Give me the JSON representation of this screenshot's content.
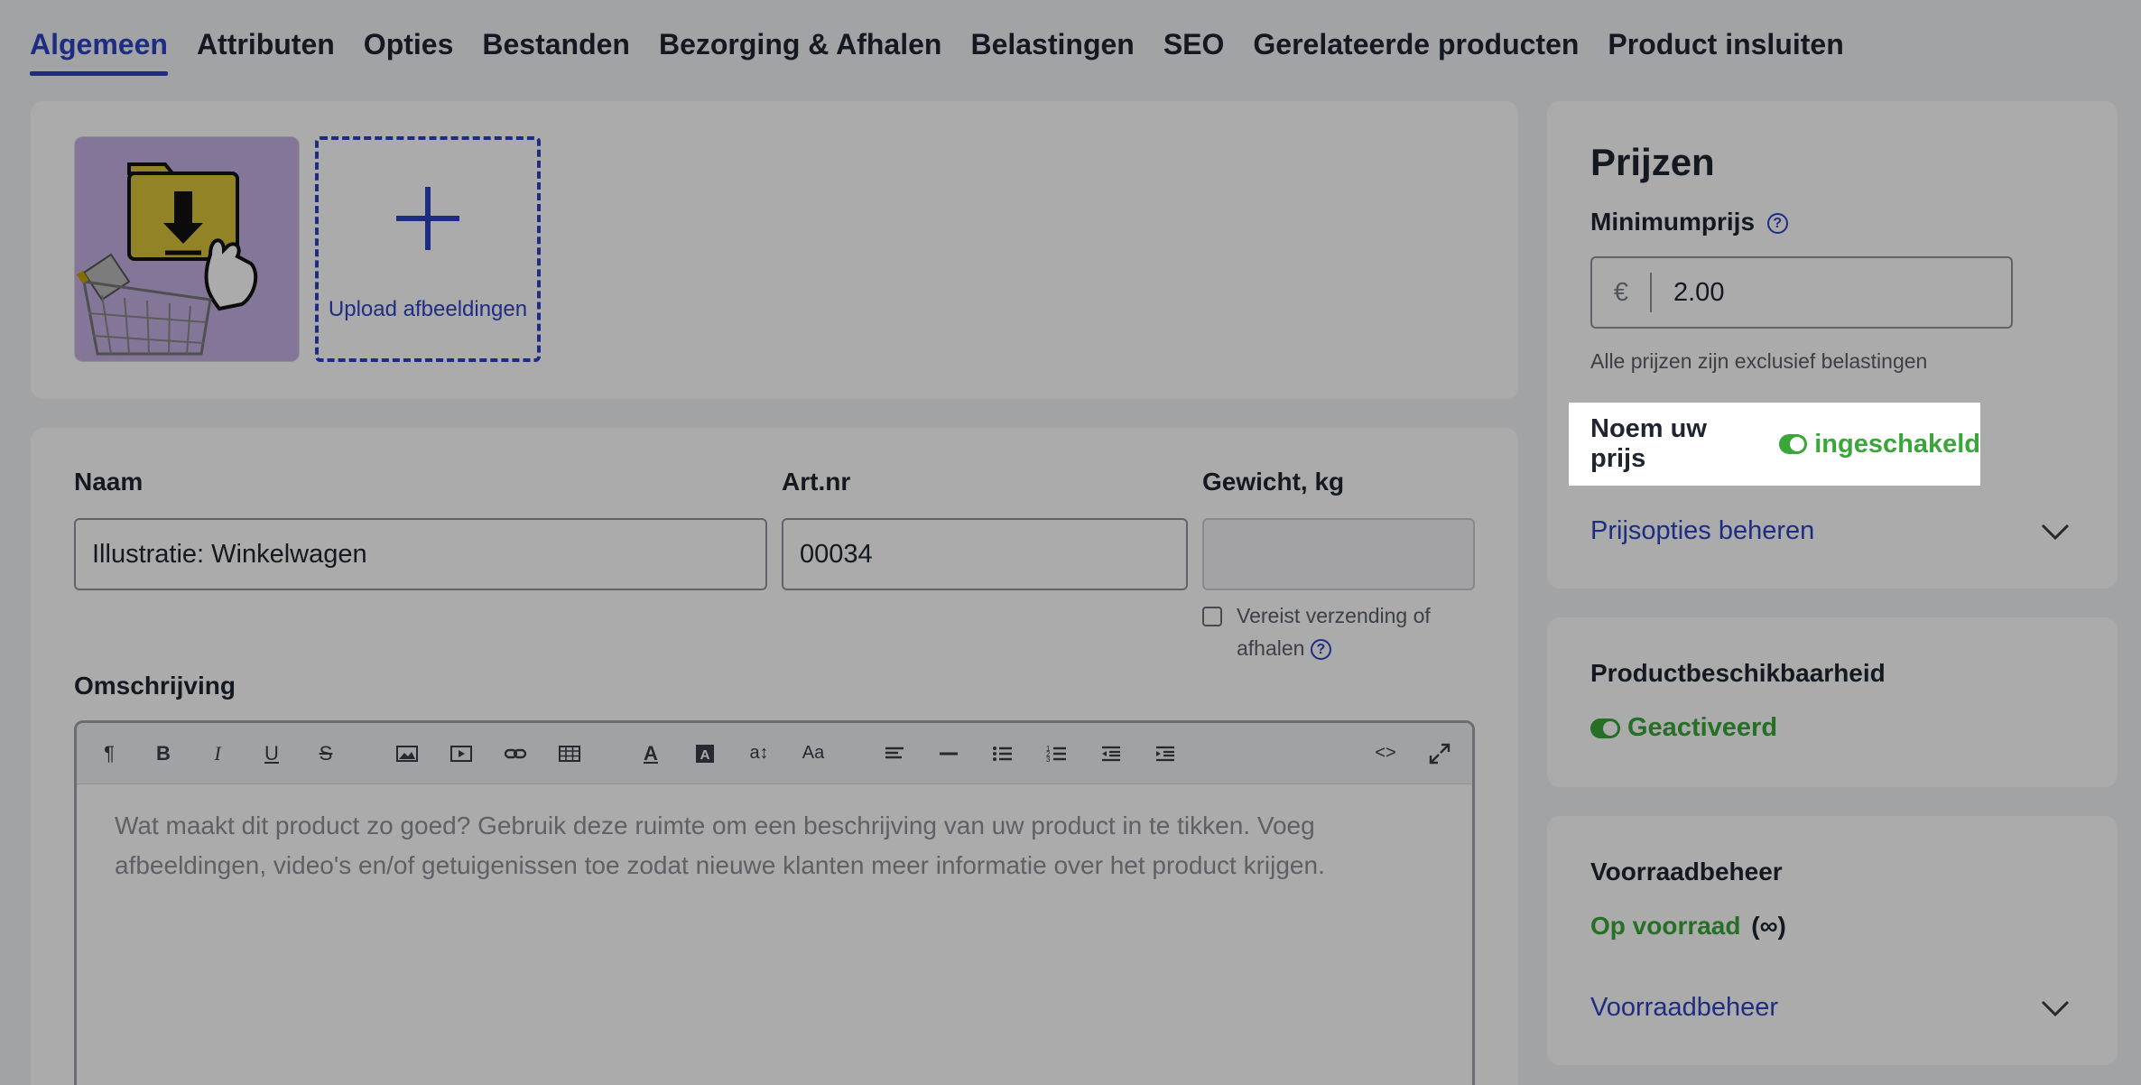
{
  "tabs": [
    {
      "label": "Algemeen",
      "active": true
    },
    {
      "label": "Attributen"
    },
    {
      "label": "Opties"
    },
    {
      "label": "Bestanden"
    },
    {
      "label": "Bezorging & Afhalen"
    },
    {
      "label": "Belastingen"
    },
    {
      "label": "SEO"
    },
    {
      "label": "Gerelateerde producten"
    },
    {
      "label": "Product insluiten"
    }
  ],
  "images": {
    "upload_label": "Upload afbeeldingen"
  },
  "form": {
    "name_label": "Naam",
    "name_value": "Illustratie: Winkelwagen",
    "sku_label": "Art.nr",
    "sku_value": "00034",
    "weight_label": "Gewicht, kg",
    "weight_value": "",
    "shipping_checkbox_label_line1": "Vereist verzending of",
    "shipping_checkbox_label_line2": "afhalen",
    "shipping_required": false,
    "description_label": "Omschrijving",
    "description_placeholder": "Wat maakt dit product zo goed? Gebruik deze ruimte om een beschrijving van uw product in te tikken. Voeg afbeeldingen, video's en/of getuigenissen toe zodat nieuwe klanten meer informatie over het product krijgen."
  },
  "pricing": {
    "title": "Prijzen",
    "min_price_label": "Minimumprijs",
    "currency_symbol": "€",
    "min_price_value": "2.00",
    "tax_note": "Alle prijzen zijn exclusief belastingen",
    "name_your_price_label": "Noem uw prijs",
    "name_your_price_status": "ingeschakeld",
    "manage_price_options": "Prijsopties beheren"
  },
  "availability": {
    "title": "Productbeschikbaarheid",
    "status": "Geactiveerd"
  },
  "inventory": {
    "title": "Voorraadbeheer",
    "status": "Op voorraad",
    "quantity": "(∞)",
    "manage_link": "Voorraadbeheer"
  },
  "colors": {
    "accent": "#2e44c4",
    "success": "#3aa63a",
    "overlay": "rgba(0,0,0,0.33)"
  }
}
